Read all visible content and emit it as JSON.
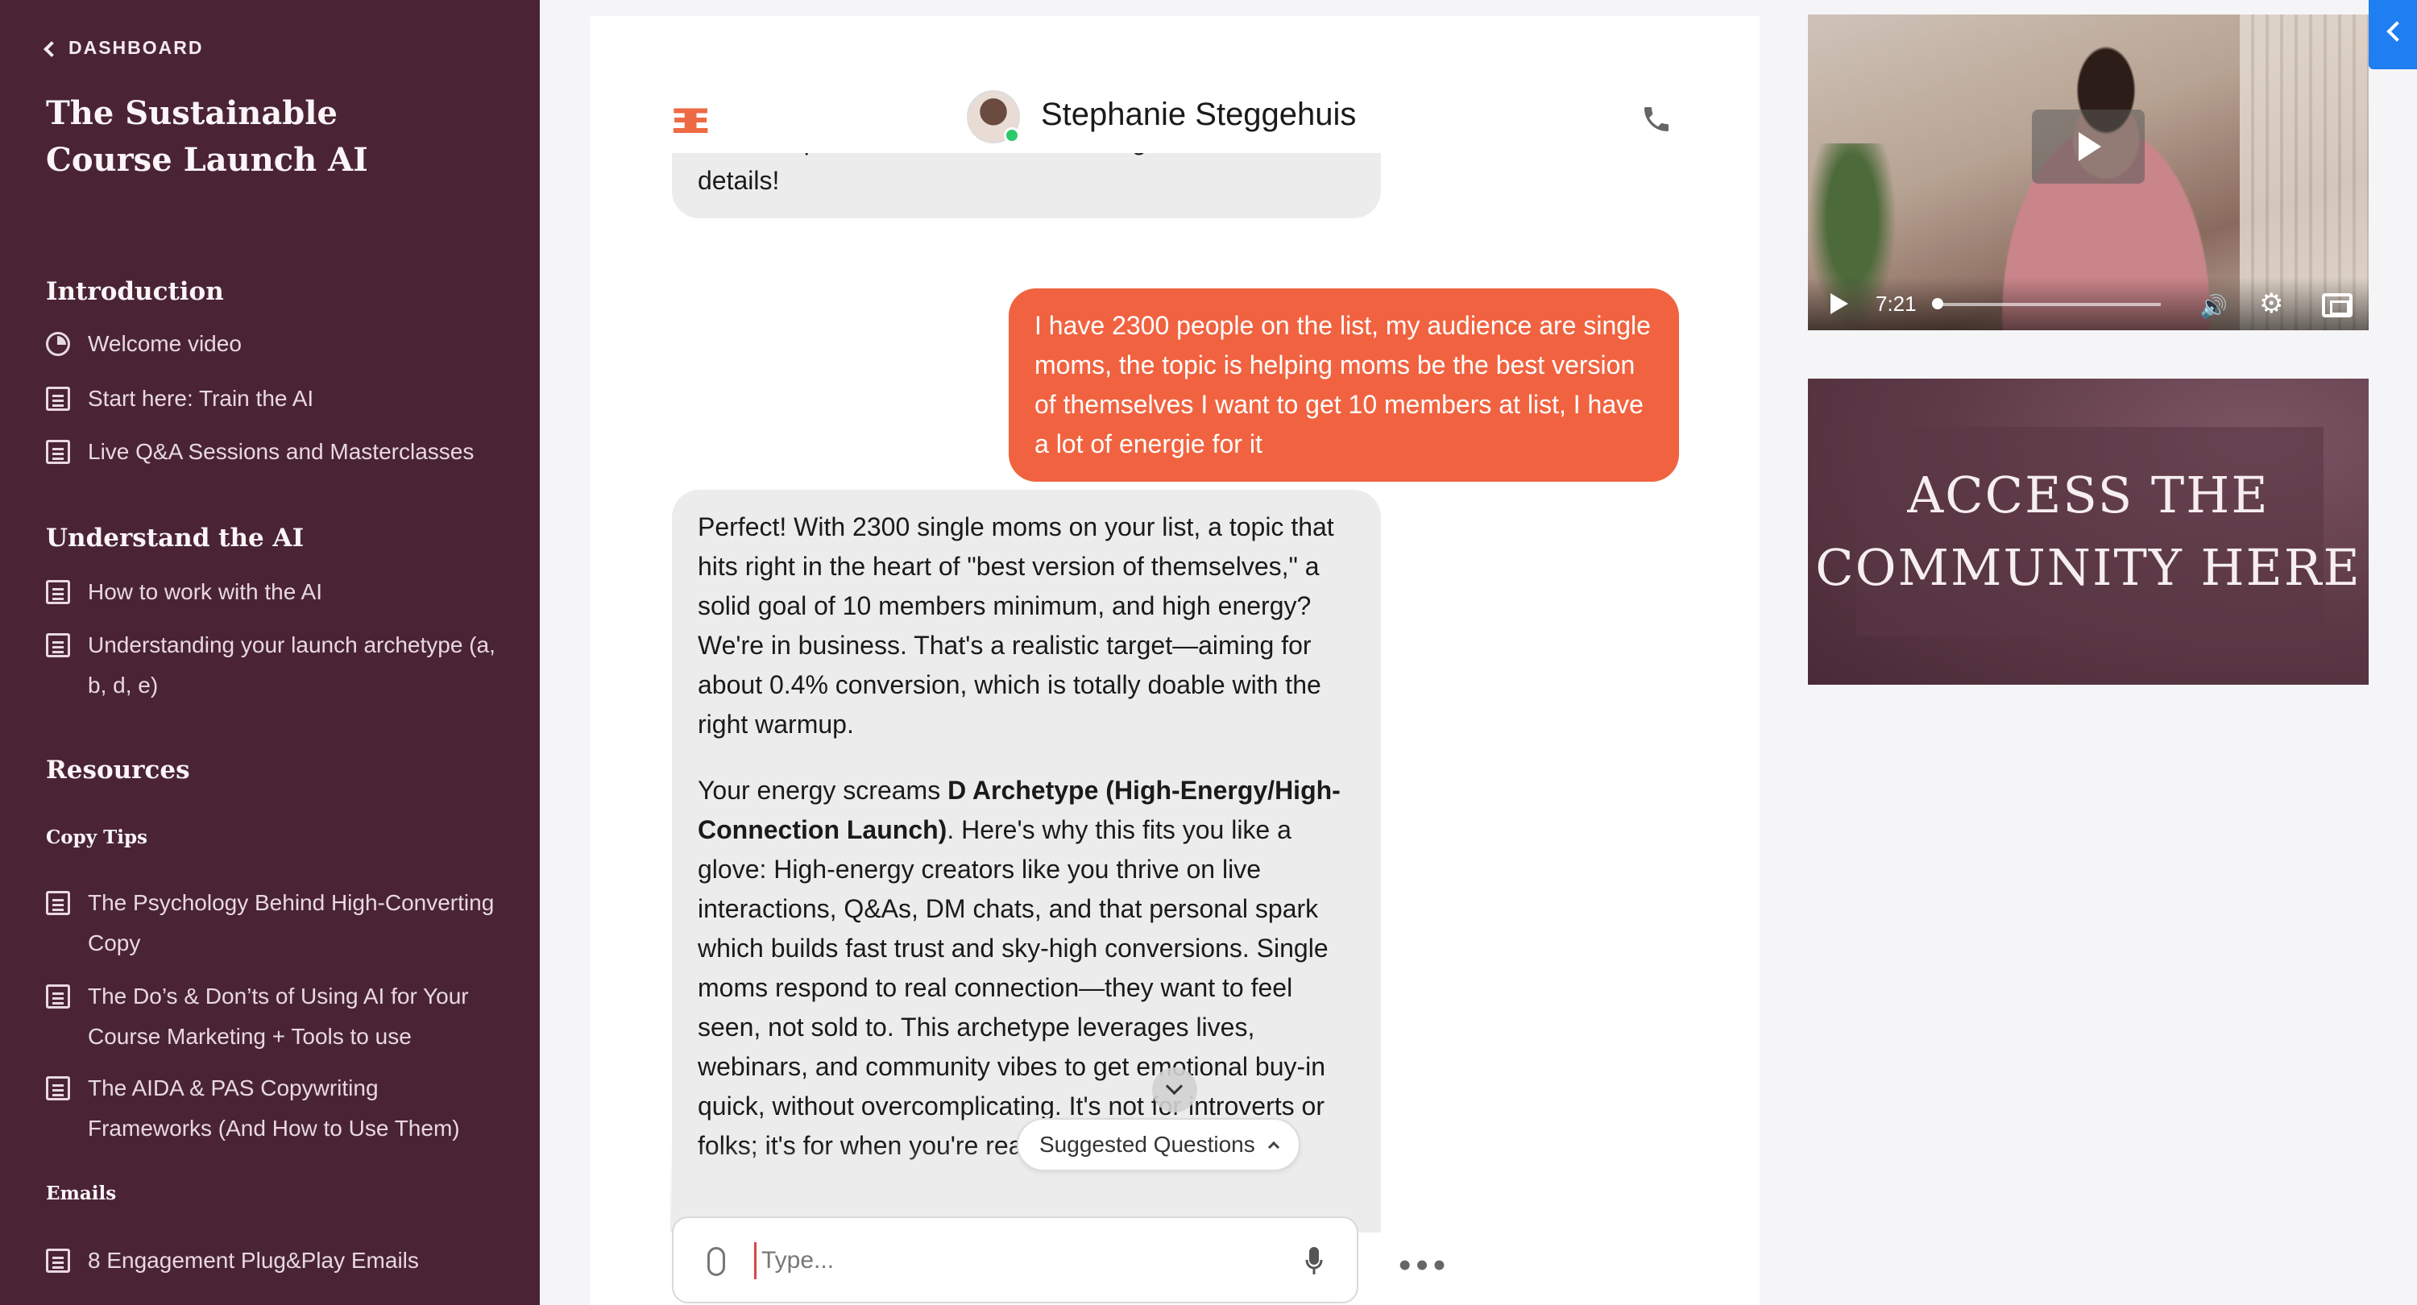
{
  "sidebar": {
    "back_label": "DASHBOARD",
    "course_title": "The Sustainable Course Launch AI",
    "sections": {
      "introduction": "Introduction",
      "understand": "Understand the AI",
      "resources": "Resources",
      "copy_tips": "Copy Tips",
      "emails": "Emails"
    },
    "items": [
      {
        "label": "Welcome video",
        "icon": "circle-progress-icon"
      },
      {
        "label": "Start here: Train the AI",
        "icon": "document-icon"
      },
      {
        "label": "Live Q&A Sessions and Masterclasses",
        "icon": "document-icon"
      },
      {
        "label": "How to work with the AI",
        "icon": "document-icon"
      },
      {
        "label": "Understanding your launch archetype (a, b, d, e)",
        "icon": "document-icon"
      },
      {
        "label": "The Psychology Behind High-Converting Copy",
        "icon": "document-icon"
      },
      {
        "label": "The Do’s & Don’ts of Using AI for Your Course Marketing + Tools to use",
        "icon": "document-icon"
      },
      {
        "label": "The AIDA & PAS Copywriting Frameworks (And How to Use Them)",
        "icon": "document-icon"
      },
      {
        "label": "8 Engagement Plug&Play Emails",
        "icon": "document-icon"
      }
    ]
  },
  "chat": {
    "logo": "ƎE",
    "agent_name": "Stephanie Steggehuis",
    "messages": [
      {
        "role": "bot",
        "text": "Paste what you have so far if you want me to review it while we plan. Your next move is hitting me with those details!"
      },
      {
        "role": "user",
        "text": "I have 2300 people on the list, my audience are single moms, the topic is helping moms be the best version of themselves I want to get 10 members at list, I have a lot of energie for it"
      },
      {
        "role": "bot",
        "p1": "Perfect! With 2300 single moms on your list, a topic that hits right in the heart of \"best version of themselves,\" a solid goal of 10 members minimum, and high energy? We're in business. That's a realistic target—aiming for about 0.4% conversion, which is totally doable with the right warmup.",
        "p2_pre": "Your energy screams ",
        "p2_bold": "D Archetype (High-Energy/High-Connection Launch)",
        "p2_post": ". Here's why this fits you like a glove: High-energy creators like you thrive on live interactions, Q&As, DM chats, and that personal spark which builds fast trust and sky-high conversions. Single moms respond to real connection—they want to feel seen, not sold to. This archetype leverages lives, webinars, and community vibes to get emotional buy-in quick, without overcomplicating. It's not for introverts or folks; it's for when you're ready to show up."
      }
    ],
    "suggested_questions_label": "Suggested Questions",
    "input_placeholder": "Type...",
    "more_label": "•••"
  },
  "video": {
    "time": "7:21",
    "progress": 0.02
  },
  "community": {
    "line1": "ACCESS THE",
    "line2": "COMMUNITY HERE"
  },
  "colors": {
    "sidebar_bg": "#4a2434",
    "user_bubble": "#f16340",
    "bot_bubble": "#ececec",
    "accent_blue": "#1f7ef0",
    "online": "#2fc96a"
  }
}
